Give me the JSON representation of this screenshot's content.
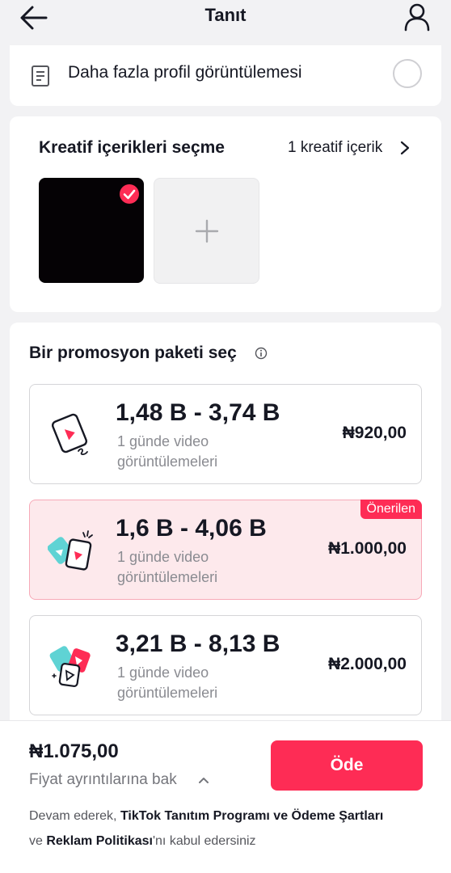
{
  "header": {
    "title": "Tanıt"
  },
  "goal": {
    "label": "Daha fazla profil görüntülemesi"
  },
  "creatives": {
    "title": "Kreatif içerikleri seçme",
    "count_label": "1 kreatif içerik"
  },
  "packages": {
    "title": "Bir promosyon paketi seç",
    "items": [
      {
        "range": "1,48 B - 3,74 B",
        "desc": "1 günde video görüntülemeleri",
        "price": "₦920,00",
        "selected": false
      },
      {
        "range": "1,6 B - 4,06 B",
        "desc": "1 günde video görüntülemeleri",
        "price": "₦1.000,00",
        "selected": true,
        "badge": "Önerilen"
      },
      {
        "range": "3,21 B - 8,13 B",
        "desc": "1 günde video görüntülemeleri",
        "price": "₦2.000,00",
        "selected": false
      }
    ]
  },
  "footer": {
    "total": "₦1.075,00",
    "details_label": "Fiyat ayrıntılarına bak",
    "pay_label": "Öde",
    "terms_prefix": "Devam ederek, ",
    "terms_link1": "TikTok Tanıtım Programı ve Ödeme Şartları",
    "terms_middle": "ve ",
    "terms_link2": "Reklam Politikası",
    "terms_suffix": "'nı kabul edersiniz"
  },
  "colors": {
    "accent": "#fe2c55",
    "selected_bg": "#fde9ec",
    "page_bg": "#f2f2f4",
    "teal": "#5fd3d4"
  }
}
